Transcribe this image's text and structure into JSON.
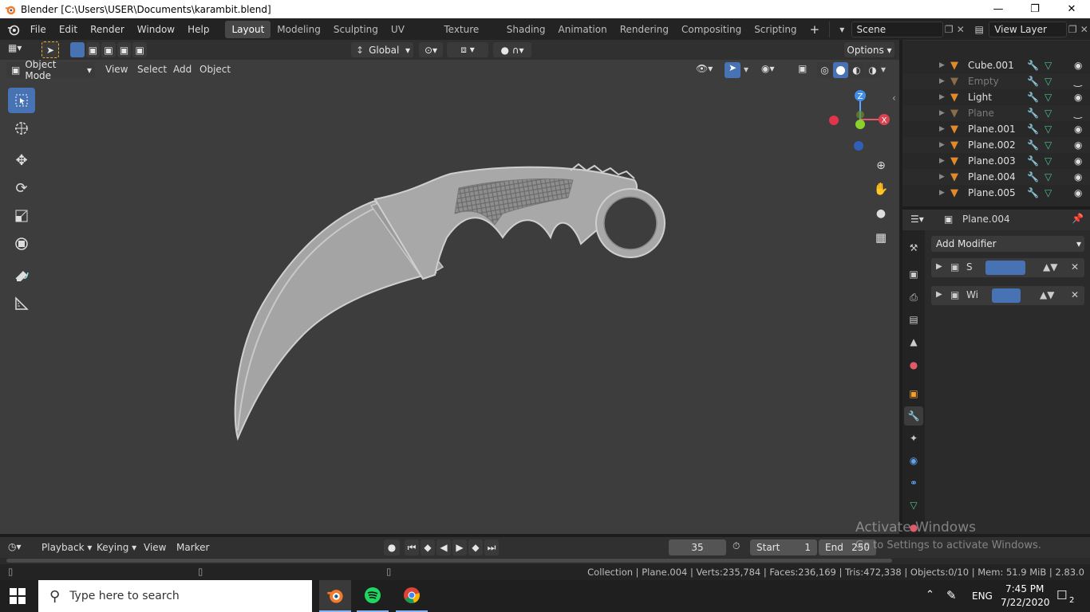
{
  "window": {
    "title": "Blender [C:\\Users\\USER\\Documents\\karambit.blend]"
  },
  "menu": [
    "File",
    "Edit",
    "Render",
    "Window",
    "Help"
  ],
  "workspaces": [
    "Layout",
    "Modeling",
    "Sculpting",
    "UV Editing",
    "Texture Paint",
    "Shading",
    "Animation",
    "Rendering",
    "Compositing",
    "Scripting"
  ],
  "active_workspace": "Layout",
  "scene": {
    "name": "Scene",
    "view_layer": "View Layer"
  },
  "viewport_header": {
    "transform_orientation": "Global",
    "options_label": "Options",
    "mode": "Object Mode",
    "menus": [
      "View",
      "Select",
      "Add",
      "Object"
    ]
  },
  "outliner": {
    "rows": [
      {
        "name": "Cube.001",
        "dim": false
      },
      {
        "name": "Empty",
        "dim": true
      },
      {
        "name": "Light",
        "dim": false
      },
      {
        "name": "Plane",
        "dim": true
      },
      {
        "name": "Plane.001",
        "dim": false
      },
      {
        "name": "Plane.002",
        "dim": false
      },
      {
        "name": "Plane.003",
        "dim": false
      },
      {
        "name": "Plane.004",
        "dim": false
      },
      {
        "name": "Plane.005",
        "dim": false
      }
    ]
  },
  "properties": {
    "object_name": "Plane.004",
    "add_modifier_label": "Add Modifier",
    "modifiers": [
      {
        "name": "S"
      },
      {
        "name": "Wi"
      }
    ]
  },
  "timeline": {
    "menus": [
      "Playback",
      "Keying",
      "View",
      "Marker"
    ],
    "current_frame": "35",
    "start_label": "Start",
    "start_value": "1",
    "end_label": "End",
    "end_value": "250"
  },
  "status": {
    "text": "Collection | Plane.004 | Verts:235,784 | Faces:236,169 | Tris:472,338 | Objects:0/10 | Mem: 51.9 MiB | 2.83.0"
  },
  "watermark": {
    "line1": "Activate Windows",
    "line2": "Go to Settings to activate Windows."
  },
  "taskbar": {
    "search_placeholder": "Type here to search",
    "language": "ENG",
    "time": "7:45 PM",
    "date": "7/22/2020",
    "notification_count": "2"
  },
  "colors": {
    "accent": "#4772b3",
    "viewport_bg": "#3d3d3d",
    "mesh_orange": "#e08a2a",
    "modifier_blue": "#5fa3e8",
    "data_green": "#4fc08a"
  },
  "icons": {
    "axis_gizmo": [
      "X",
      "Y",
      "Z"
    ]
  }
}
